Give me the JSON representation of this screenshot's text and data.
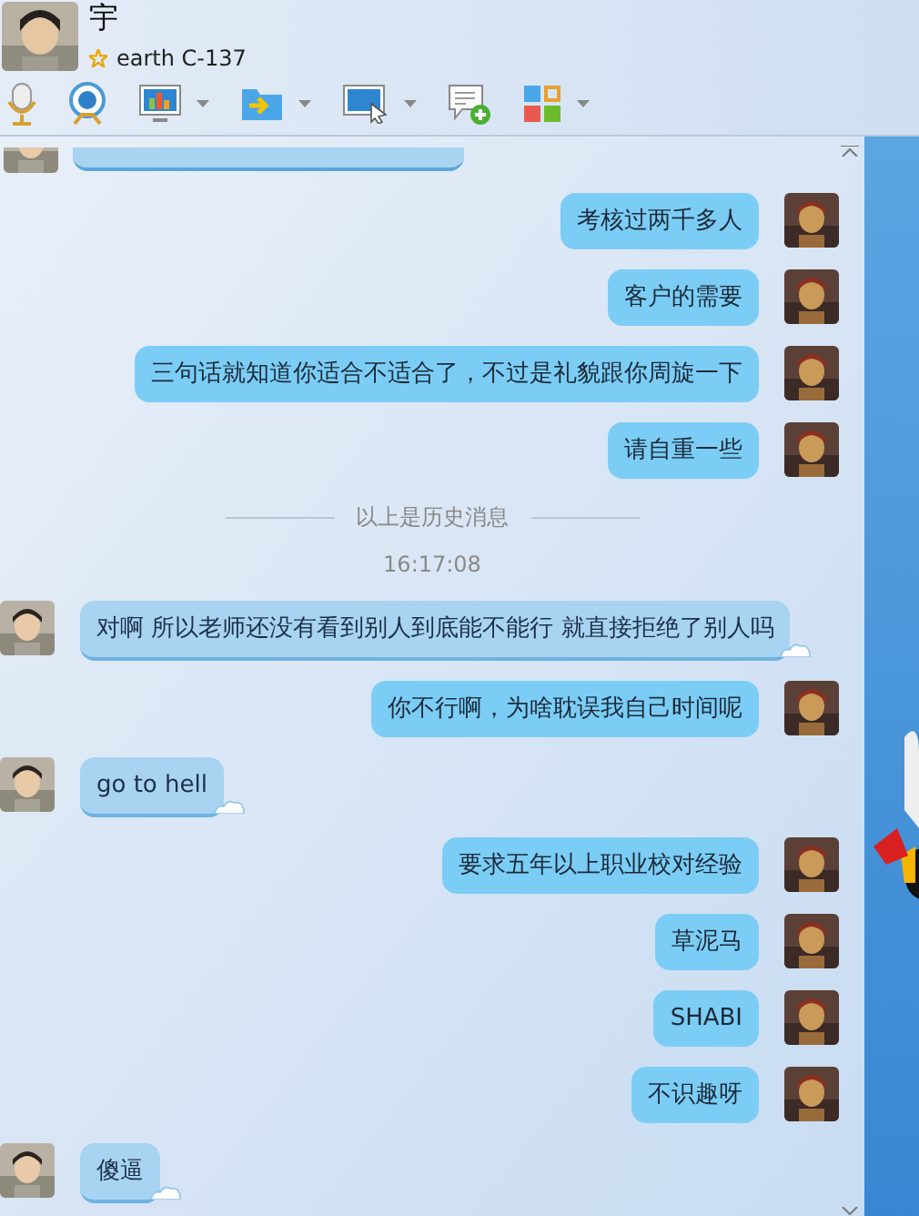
{
  "contact": {
    "name": "宇",
    "status": "earth C-137"
  },
  "toolbar": [
    {
      "kind": "mic",
      "menu": false
    },
    {
      "kind": "camera",
      "menu": false
    },
    {
      "kind": "screen-chart",
      "menu": true
    },
    {
      "kind": "folder",
      "menu": true
    },
    {
      "kind": "screen-cursor",
      "menu": true
    },
    {
      "kind": "chat-add",
      "menu": false
    },
    {
      "kind": "apps",
      "menu": true
    }
  ],
  "messages": [
    {
      "kind": "partial"
    },
    {
      "kind": "sent",
      "text": "考核过两千多人"
    },
    {
      "kind": "sent",
      "text": "客户的需要"
    },
    {
      "kind": "sent",
      "text": "三句话就知道你适合不适合了，不过是礼貌跟你周旋一下"
    },
    {
      "kind": "sent",
      "text": "请自重一些"
    },
    {
      "kind": "divider",
      "text": "以上是历史消息"
    },
    {
      "kind": "time",
      "text": "16:17:08"
    },
    {
      "kind": "received",
      "text": "对啊 所以老师还没有看到别人到底能不能行 就直接拒绝了别人吗"
    },
    {
      "kind": "sent",
      "text": "你不行啊，为啥耽误我自己时间呢"
    },
    {
      "kind": "received",
      "text": "go to hell"
    },
    {
      "kind": "sent",
      "text": "要求五年以上职业校对经验"
    },
    {
      "kind": "sent",
      "text": "草泥马"
    },
    {
      "kind": "sent",
      "text": "SHABI"
    },
    {
      "kind": "sent",
      "text": "不识趣呀"
    },
    {
      "kind": "received",
      "text": "傻逼"
    }
  ]
}
